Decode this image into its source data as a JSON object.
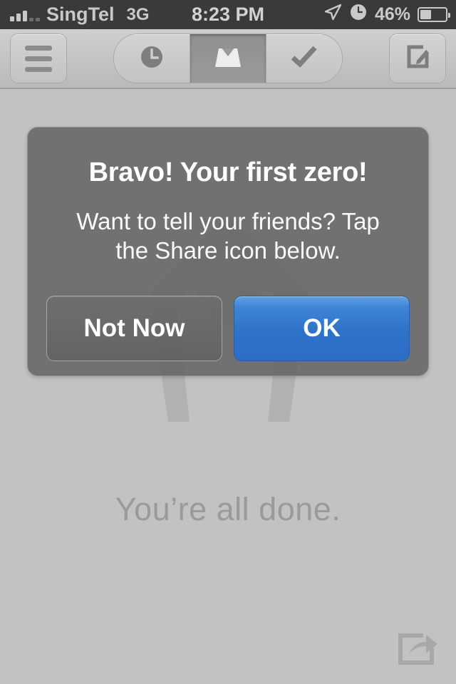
{
  "status_bar": {
    "signal_icon": "signal-bars-icon",
    "carrier": "SingTel",
    "network_type": "3G",
    "time": "8:23 PM",
    "location_icon": "location-arrow-icon",
    "alarm_icon": "alarm-clock-icon",
    "battery_percent": "46%",
    "battery_icon": "battery-icon",
    "battery_level": 46,
    "background_color": "#3a3a3a",
    "text_color": "#c9c9c9"
  },
  "toolbar": {
    "menu_button": {
      "name": "hamburger-menu-icon",
      "label": "Menu"
    },
    "segments": [
      {
        "name": "later-tab",
        "icon": "clock-icon",
        "label": "Later",
        "selected": false
      },
      {
        "name": "inbox-tab",
        "icon": "inbox-icon",
        "label": "Inbox",
        "selected": true
      },
      {
        "name": "archive-tab",
        "icon": "checkmark-icon",
        "label": "Archive",
        "selected": false
      }
    ],
    "compose_button": {
      "name": "compose-icon",
      "label": "Compose"
    }
  },
  "content": {
    "empty_state_text": "You’re all done.",
    "share_button": {
      "name": "share-icon",
      "label": "Share"
    }
  },
  "alert": {
    "title": "Bravo! Your first zero!",
    "message": "Want to tell your friends? Tap the Share icon below.",
    "buttons": [
      {
        "name": "not-now-button",
        "label": "Not Now",
        "style": "secondary"
      },
      {
        "name": "ok-button",
        "label": "OK",
        "style": "primary"
      }
    ]
  },
  "colors": {
    "screen_background": "#c2c2c2",
    "toolbar_background": "#c8c8c8",
    "status_bar_background": "#3a3a3a",
    "alert_background": "#5f5f5f",
    "primary_button": "#2f72c9",
    "muted_text": "#9a9a9a"
  }
}
